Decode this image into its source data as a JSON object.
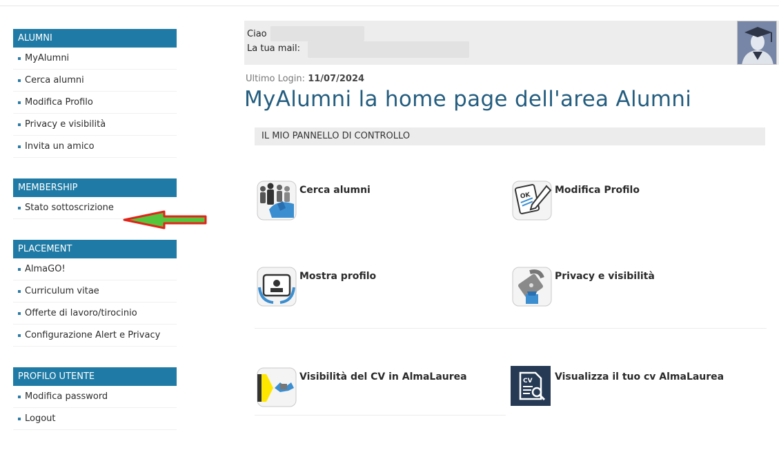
{
  "sidebar": {
    "alumni": {
      "heading": "ALUMNI",
      "items": [
        "MyAlumni",
        "Cerca alumni",
        "Modifica Profilo",
        "Privacy e visibilità",
        "Invita un amico"
      ]
    },
    "membership": {
      "heading": "MEMBERSHIP",
      "items": [
        "Stato sottoscrizione"
      ]
    },
    "placement": {
      "heading": "PLACEMENT",
      "items": [
        "AlmaGO!",
        "Curriculum vitae",
        "Offerte di lavoro/tirocinio",
        "Configurazione Alert e Privacy"
      ]
    },
    "profilo": {
      "heading": "PROFILO UTENTE",
      "items": [
        "Modifica password",
        "Logout"
      ]
    }
  },
  "user": {
    "greeting": "Ciao",
    "mail_label": "La tua mail:"
  },
  "last_login": {
    "label": "Ultimo Login:",
    "date": "11/07/2024"
  },
  "page_title": "MyAlumni la home page dell'area Alumni",
  "panel_title": "IL MIO PANNELLO DI CONTROLLO",
  "tiles": {
    "cerca": "Cerca alumni",
    "modifica": "Modifica Profilo",
    "mostra": "Mostra profilo",
    "privacy": "Privacy e visibilità",
    "visibilita_cv": "Visibilità del CV in AlmaLaurea",
    "visualizza_cv": "Visualizza il tuo cv AlmaLaurea"
  },
  "colors": {
    "sidebar_heading": "#1f7ba5",
    "title": "#245d7f",
    "arrow_fill": "#55c53d",
    "arrow_outline": "#e2231a"
  }
}
